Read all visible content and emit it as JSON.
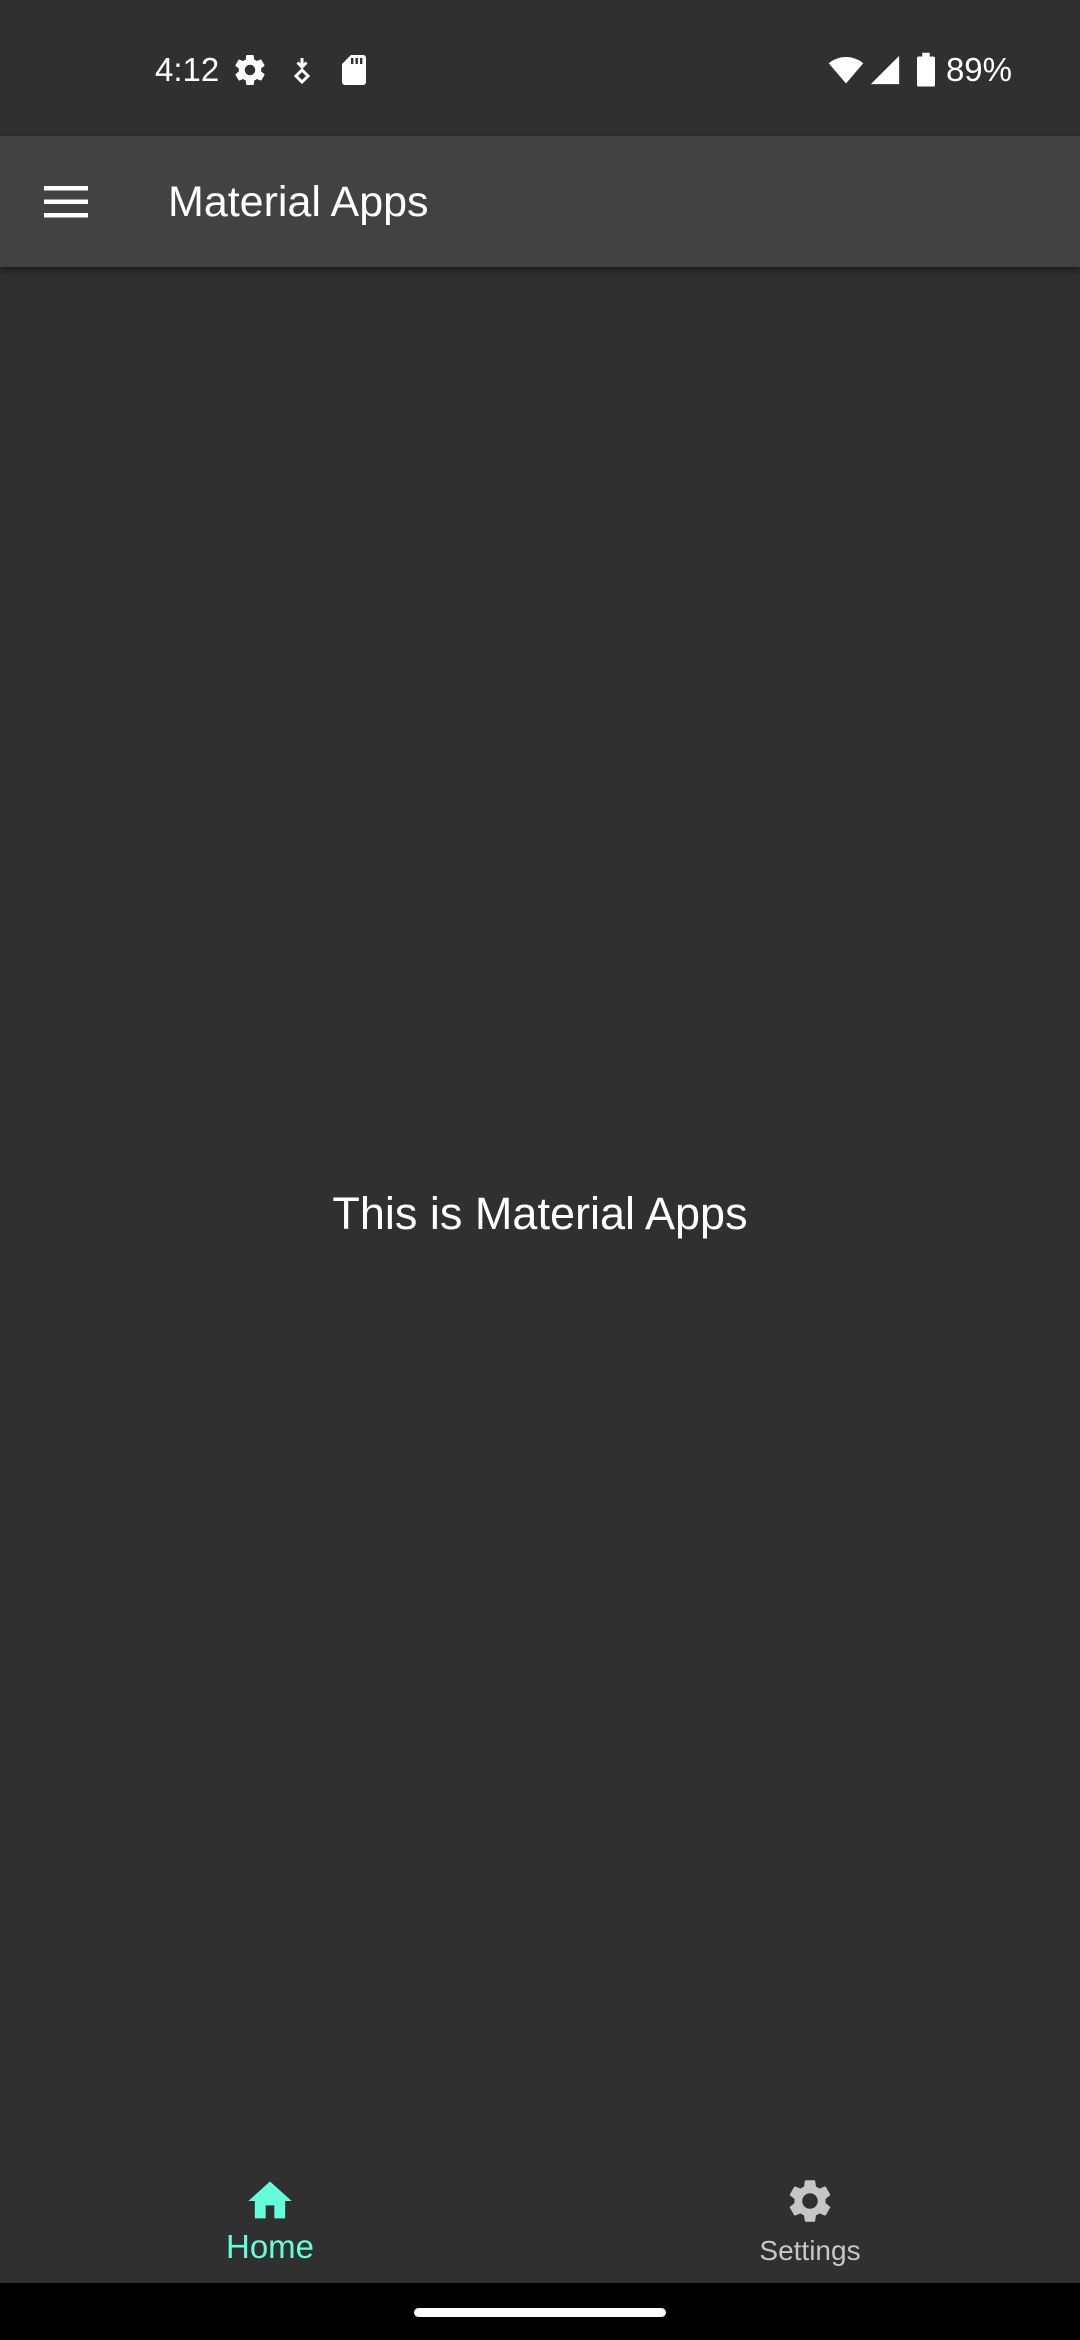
{
  "status_bar": {
    "time": "4:12",
    "battery": "89%",
    "icons": [
      "settings-gear-icon",
      "data-saver-icon",
      "sd-card-icon",
      "wifi-icon",
      "cellular-signal-icon",
      "battery-icon"
    ]
  },
  "app_bar": {
    "title": "Material Apps",
    "menu_icon": "hamburger-menu-icon"
  },
  "main": {
    "message": "This is Material Apps"
  },
  "bottom_nav": {
    "items": [
      {
        "label": "Home",
        "icon": "home-icon",
        "active": true,
        "color": "#64ffda"
      },
      {
        "label": "Settings",
        "icon": "settings-icon",
        "active": false,
        "color": "#c6c6c6"
      }
    ]
  },
  "colors": {
    "background": "#303030",
    "app_bar": "#424242",
    "accent": "#64ffda"
  }
}
